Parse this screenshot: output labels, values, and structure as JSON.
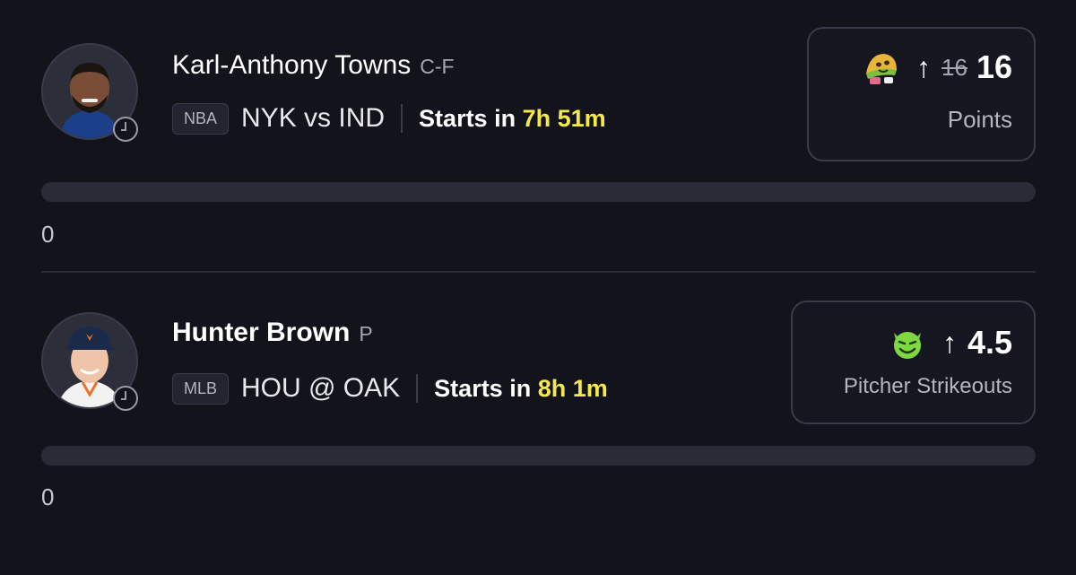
{
  "picks": [
    {
      "player_name": "Karl-Anthony Towns",
      "position": "C-F",
      "league": "NBA",
      "matchup": "NYK vs IND",
      "starts_prefix": "Starts in",
      "starts_time": "7h 51m",
      "emoji_icon": "taco-emoji-icon",
      "direction_icon": "arrow-up-icon",
      "original_line": "16",
      "line": "16",
      "stat": "Points",
      "progress_value": "0",
      "progress_fraction": 0
    },
    {
      "player_name": "Hunter Brown",
      "position": "P",
      "league": "MLB",
      "matchup": "HOU @ OAK",
      "starts_prefix": "Starts in",
      "starts_time": "8h 1m",
      "emoji_icon": "goblin-emoji-icon",
      "direction_icon": "arrow-up-icon",
      "line": "4.5",
      "stat": "Pitcher Strikeouts",
      "progress_value": "0",
      "progress_fraction": 0
    }
  ],
  "colors": {
    "background": "#13131c",
    "highlight": "#f5e84a",
    "card_border": "#3a3b48",
    "bar": "#2a2b36"
  }
}
